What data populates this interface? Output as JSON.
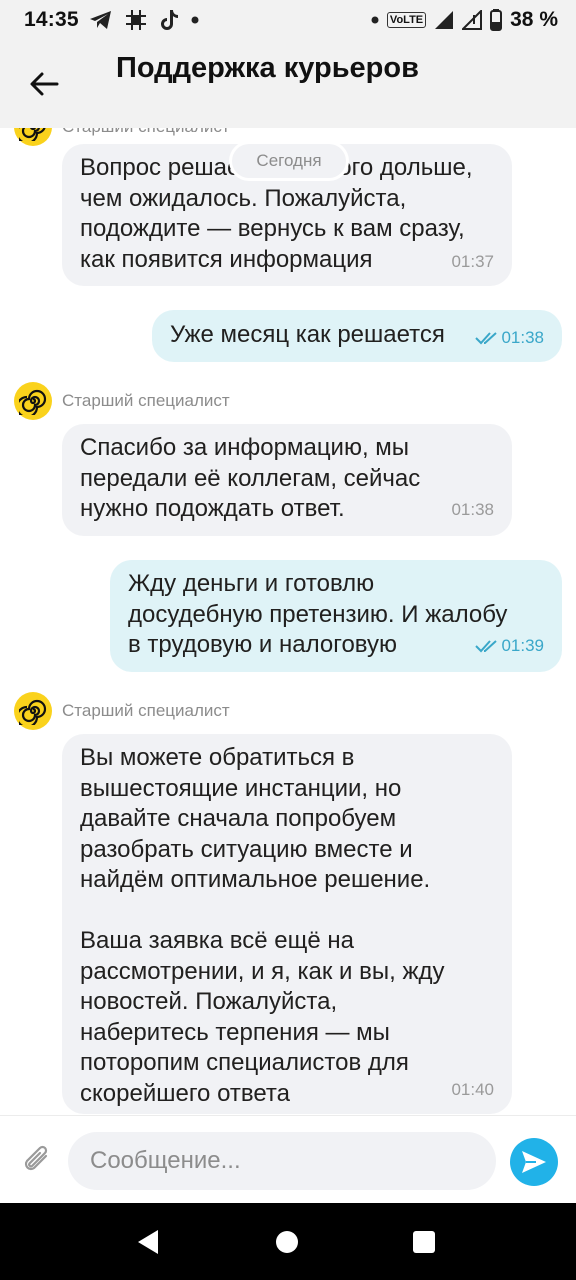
{
  "status_bar": {
    "time": "14:35",
    "volte": "VoLTE",
    "battery": "38 %"
  },
  "header": {
    "title": "Поддержка курьеров"
  },
  "chat": {
    "date_pill": "Сегодня",
    "top_sender_name": "Старший специалист",
    "messages": [
      {
        "direction": "incoming",
        "text": "Вопрос решается немного дольше,\nчем ожидалось. Пожалуйста,\nподождите — вернусь к вам сразу,\nкак появится информация",
        "time": "01:37"
      },
      {
        "direction": "outgoing",
        "text": "Уже месяц как решается",
        "time": "01:38",
        "read": true
      },
      {
        "direction": "incoming",
        "sender": "Старший специалист",
        "text": "Спасибо за информацию, мы\nпередали её коллегам, сейчас\nнужно подождать ответ.",
        "time": "01:38"
      },
      {
        "direction": "outgoing",
        "text": "Жду деньги и готовлю\nдосудебную претензию. И жалобу\nв трудовую и налоговую",
        "time": "01:39",
        "read": true
      },
      {
        "direction": "incoming",
        "sender": "Старший специалист",
        "text": "Вы можете обратиться в\nвышестоящие инстанции, но\nдавайте сначала попробуем\nразобрать ситуацию вместе и\nнайдём оптимальное решение.\n\nВаша заявка всё ещё на\nрассмотрении, и я, как и вы, жду\nновостей. Пожалуйста,\nнаберитесь терпения — мы\nпоторопим специалистов для\nскорейшего ответа",
        "time": "01:40"
      }
    ]
  },
  "composer": {
    "placeholder": "Сообщение..."
  },
  "colors": {
    "incoming_bubble": "#f1f2f5",
    "outgoing_bubble": "#dff3f7",
    "read_ticks": "#3aa7c9",
    "avatar": "#fad21c",
    "send_button": "#21b2e8"
  },
  "icons": [
    "telegram-icon",
    "grid-icon",
    "tiktok-icon",
    "dot-icon",
    "signal-icon",
    "battery-icon",
    "back-arrow-icon",
    "paperclip-icon",
    "send-icon",
    "nav-back-icon",
    "nav-home-icon",
    "nav-recents-icon"
  ]
}
